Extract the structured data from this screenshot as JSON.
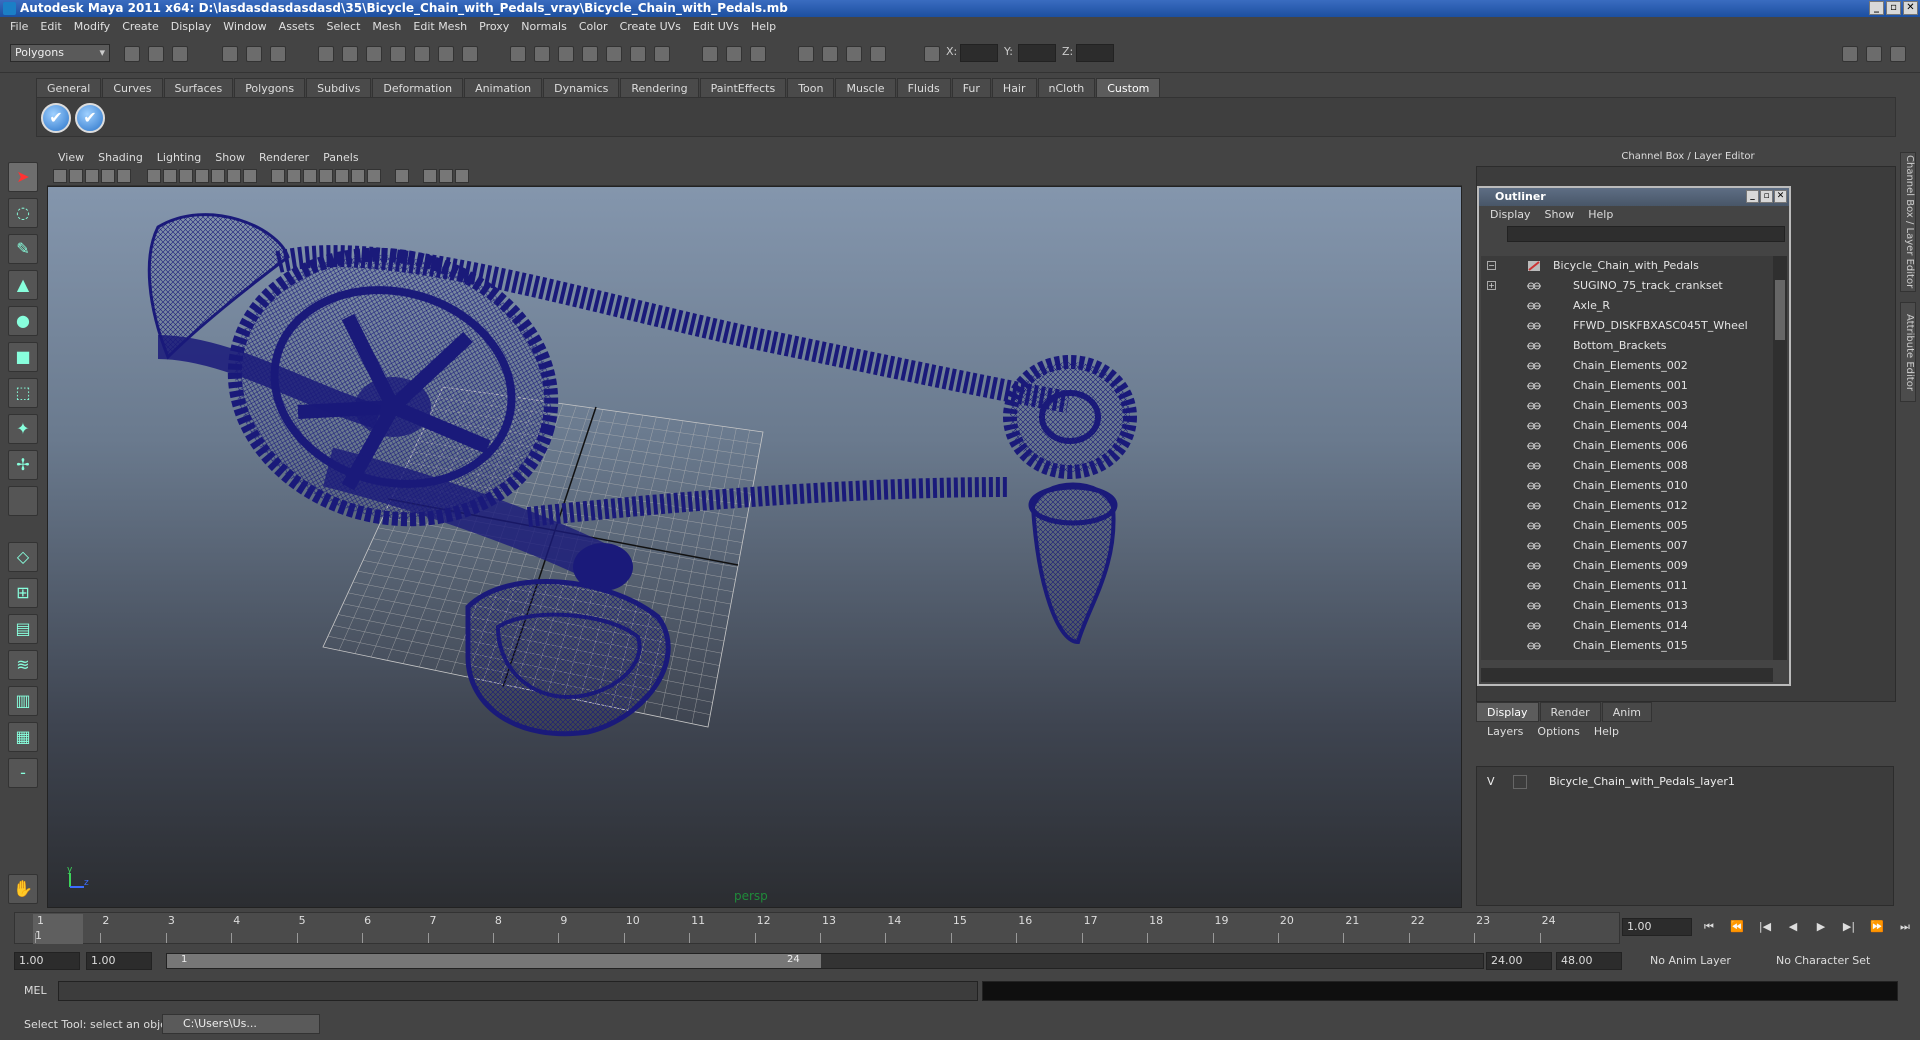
{
  "window": {
    "title": "Autodesk Maya 2011 x64: D:\\lasdasdasdasdasd\\35\\Bicycle_Chain_with_Pedals_vray\\Bicycle_Chain_with_Pedals.mb",
    "controls": [
      "_",
      "▫",
      "✕"
    ]
  },
  "menubar": [
    "File",
    "Edit",
    "Modify",
    "Create",
    "Display",
    "Window",
    "Assets",
    "Select",
    "Mesh",
    "Edit Mesh",
    "Proxy",
    "Normals",
    "Color",
    "Create UVs",
    "Edit UVs",
    "Help"
  ],
  "status": {
    "mode": "Polygons",
    "x_label": "X:",
    "y_label": "Y:",
    "z_label": "Z:"
  },
  "shelf": {
    "tabs": [
      "General",
      "Curves",
      "Surfaces",
      "Polygons",
      "Subdivs",
      "Deformation",
      "Animation",
      "Dynamics",
      "Rendering",
      "PaintEffects",
      "Toon",
      "Muscle",
      "Fluids",
      "Fur",
      "Hair",
      "nCloth",
      "Custom"
    ],
    "active_tab": "Custom",
    "buttons": [
      "✔",
      "✔"
    ]
  },
  "viewport": {
    "menu": [
      "View",
      "Shading",
      "Lighting",
      "Show",
      "Renderer",
      "Panels"
    ],
    "camera": "persp",
    "wire_color": "#1a1a7a"
  },
  "channel_box": {
    "title": "Channel Box / Layer Editor"
  },
  "outliner": {
    "title": "Outliner",
    "menu": [
      "Display",
      "Show",
      "Help"
    ],
    "items": [
      {
        "label": "Bicycle_Chain_with_Pedals",
        "expander": "−",
        "root": true
      },
      {
        "label": "SUGINO_75_track_crankset",
        "expander": "+"
      },
      {
        "label": "Axle_R"
      },
      {
        "label": "FFWD_DISKFBXASC045T_Wheel"
      },
      {
        "label": "Bottom_Brackets"
      },
      {
        "label": "Chain_Elements_002"
      },
      {
        "label": "Chain_Elements_001"
      },
      {
        "label": "Chain_Elements_003"
      },
      {
        "label": "Chain_Elements_004"
      },
      {
        "label": "Chain_Elements_006"
      },
      {
        "label": "Chain_Elements_008"
      },
      {
        "label": "Chain_Elements_010"
      },
      {
        "label": "Chain_Elements_012"
      },
      {
        "label": "Chain_Elements_005"
      },
      {
        "label": "Chain_Elements_007"
      },
      {
        "label": "Chain_Elements_009"
      },
      {
        "label": "Chain_Elements_011"
      },
      {
        "label": "Chain_Elements_013"
      },
      {
        "label": "Chain_Elements_014"
      },
      {
        "label": "Chain_Elements_015"
      }
    ]
  },
  "layer_editor": {
    "tabs": [
      "Display",
      "Render",
      "Anim"
    ],
    "active_tab": "Display",
    "menu": [
      "Layers",
      "Options",
      "Help"
    ],
    "layers": [
      {
        "visible": "V",
        "name": "Bicycle_Chain_with_Pedals_layer1"
      }
    ]
  },
  "timeline": {
    "ticks": [
      "1",
      "2",
      "3",
      "4",
      "5",
      "6",
      "7",
      "8",
      "9",
      "10",
      "11",
      "12",
      "13",
      "14",
      "15",
      "16",
      "17",
      "18",
      "19",
      "20",
      "21",
      "22",
      "23",
      "24"
    ],
    "current_frame_marker": "1",
    "current_time": "1.00",
    "playback_buttons": [
      "⏮",
      "⏪",
      "|◀",
      "◀",
      "▶",
      "▶|",
      "⏩",
      "⏭"
    ]
  },
  "range": {
    "start": "1.00",
    "playback_start": "1.00",
    "slider_start": "1",
    "slider_end": "24",
    "playback_end": "24.00",
    "end": "48.00",
    "anim_layer": "No Anim Layer",
    "character_set": "No Character Set"
  },
  "command": {
    "label": "MEL"
  },
  "help": {
    "text": "Select Tool: select an object",
    "task_button": "C:\\Users\\Us..."
  },
  "side_tabs": [
    "Channel Box / Layer Editor",
    "Attribute Editor"
  ]
}
